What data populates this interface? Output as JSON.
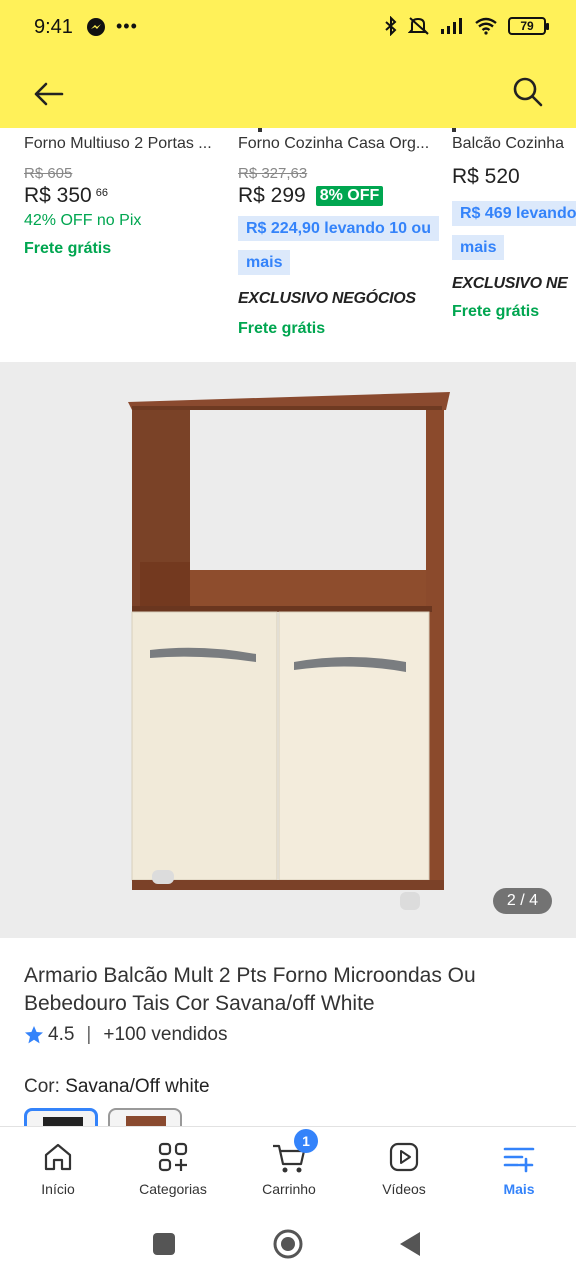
{
  "status": {
    "time": "9:41",
    "battery": "79"
  },
  "carousel": [
    {
      "title": "Forno Multiuso 2 Portas ...",
      "old_price": "R$ 605",
      "price": "R$ 350",
      "cents": "66",
      "discount_note": "42% OFF no Pix",
      "shipping": "Frete grátis"
    },
    {
      "title": "Forno Cozinha Casa Org...",
      "old_price": "R$ 327,63",
      "price": "R$ 299",
      "off_badge": "8% OFF",
      "bulk_offer": "R$ 224,90 levando 10 ou mais",
      "exclusive": "EXCLUSIVO NEGÓCIOS",
      "shipping": "Frete grátis"
    },
    {
      "title": "Balcão Cozinha",
      "price": "R$ 520",
      "bulk_offer": "R$ 469 levando ...",
      "bulk_offer_line2": "mais",
      "exclusive": "EXCLUSIVO NE",
      "shipping": "Frete grátis"
    }
  ],
  "gallery": {
    "counter": "2 / 4"
  },
  "product": {
    "title": "Armario Balcão Mult 2 Pts Forno Microondas Ou Bebedouro Tais Cor Savana/off White",
    "rating": "4.5",
    "sold": "+100 vendidos",
    "color_label": "Cor:",
    "color_value": "Savana/Off white"
  },
  "nav": {
    "items": [
      {
        "label": "Início",
        "icon": "home-icon"
      },
      {
        "label": "Categorias",
        "icon": "categories-icon"
      },
      {
        "label": "Carrinho",
        "icon": "cart-icon",
        "badge": "1"
      },
      {
        "label": "Vídeos",
        "icon": "video-icon"
      },
      {
        "label": "Mais",
        "icon": "more-icon"
      }
    ]
  },
  "colors": {
    "brand_yellow": "#fff159",
    "accent_blue": "#3483fa",
    "green": "#00a650"
  }
}
